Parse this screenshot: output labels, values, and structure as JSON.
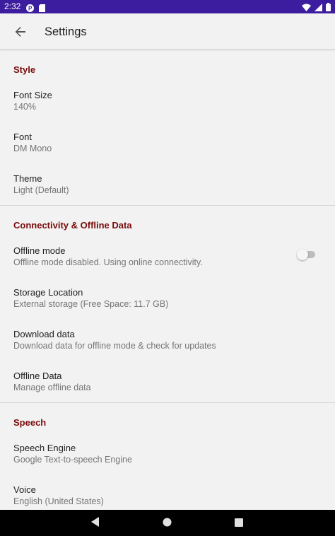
{
  "status_bar": {
    "time": "2:32",
    "icons": [
      "pocketcasts-icon",
      "sd-card-icon",
      "wifi-icon",
      "signal-icon",
      "battery-icon"
    ],
    "color": "#3d1d9f"
  },
  "app_bar": {
    "back_icon": "arrow-back-icon",
    "title": "Settings"
  },
  "accent_color": "#7a0b0b",
  "sections": {
    "style": {
      "header": "Style",
      "items": [
        {
          "title": "Font Size",
          "summary": "140%"
        },
        {
          "title": "Font",
          "summary": "DM Mono"
        },
        {
          "title": "Theme",
          "summary": "Light (Default)"
        }
      ]
    },
    "connectivity": {
      "header": "Connectivity & Offline Data",
      "items": [
        {
          "title": "Offline mode",
          "summary": "Offline mode disabled. Using online connectivity.",
          "toggle": "off"
        },
        {
          "title": "Storage Location",
          "summary": "External storage (Free Space: 11.7 GB)"
        },
        {
          "title": "Download data",
          "summary": "Download data for offline mode & check for updates"
        },
        {
          "title": "Offline Data",
          "summary": "Manage offline data"
        }
      ]
    },
    "speech": {
      "header": "Speech",
      "items": [
        {
          "title": "Speech Engine",
          "summary": "Google Text-to-speech Engine"
        },
        {
          "title": "Voice",
          "summary": "English (United States)"
        }
      ]
    }
  },
  "nav_bar": {
    "buttons": [
      "back-triangle-icon",
      "home-circle-icon",
      "recents-square-icon"
    ]
  }
}
